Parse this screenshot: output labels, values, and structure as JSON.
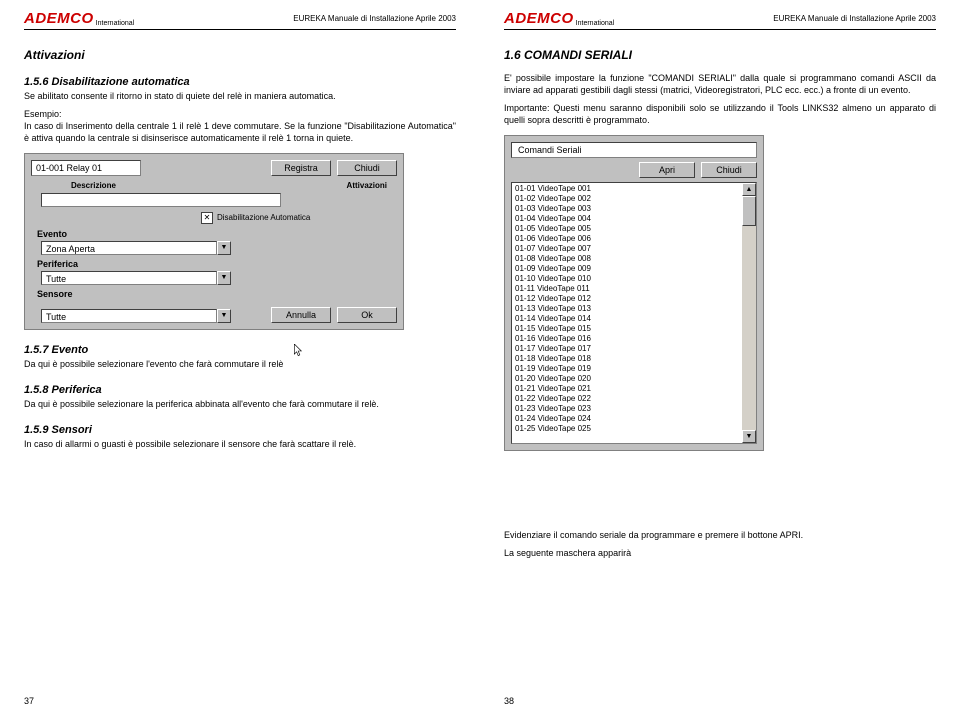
{
  "header": {
    "logo_main": "ADEMCO",
    "logo_sub": "International",
    "doc_title": "EUREKA Manuale di Installazione Aprile 2003"
  },
  "left": {
    "title": "Attivazioni",
    "s156_title": "1.5.6 Disabilitazione automatica",
    "s156_p1": "Se abilitato consente il ritorno in stato di quiete del relè in maniera automatica.",
    "s156_p2": "Esempio:",
    "s156_p3": "In caso di Inserimento della centrale 1 il relè 1 deve commutare. Se la funzione \"Disabilitazione Automatica\" è attiva quando la centrale si disinserisce automaticamente il relè 1 torna in quiete.",
    "shot1": {
      "id_value": "01-001 Relay 01",
      "btn_registra": "Registra",
      "btn_chiudi": "Chiudi",
      "lbl_descrizione": "Descrizione",
      "lbl_attivazioni": "Attivazioni",
      "chk_label": "Disabilitazione Automatica",
      "evento_label": "Evento",
      "evento_value": "Zona Aperta",
      "periferica_label": "Periferica",
      "periferica_value": "Tutte",
      "sensore_label": "Sensore",
      "sensore_value": "Tutte",
      "btn_annulla": "Annulla",
      "btn_ok": "Ok"
    },
    "s157_title": "1.5.7 Evento",
    "s157_p": "Da qui è possibile selezionare l'evento che farà commutare il relè",
    "s158_title": "1.5.8 Periferica",
    "s158_p": "Da qui è possibile selezionare la periferica abbinata all'evento che farà commutare il relè.",
    "s159_title": "1.5.9 Sensori",
    "s159_p": "In caso di allarmi o guasti è possibile selezionare il sensore che farà scattare il relè.",
    "page_num": "37"
  },
  "right": {
    "title": "1.6 COMANDI SERIALI",
    "p1": "E' possibile impostare la funzione \"COMANDI SERIALI\" dalla quale si programmano comandi ASCII da inviare ad apparati gestibili dagli stessi (matrici, Videoregistratori, PLC ecc. ecc.) a fronte di un evento.",
    "p2": "Importante: Questi menu saranno disponibili solo se utilizzando il Tools LINKS32 almeno un apparato di quelli sopra descritti è programmato.",
    "shot2": {
      "title": "Comandi Seriali",
      "btn_apri": "Apri",
      "btn_chiudi": "Chiudi",
      "items": [
        "01-01 VideoTape 001",
        "01-02 VideoTape 002",
        "01-03 VideoTape 003",
        "01-04 VideoTape 004",
        "01-05 VideoTape 005",
        "01-06 VideoTape 006",
        "01-07 VideoTape 007",
        "01-08 VideoTape 008",
        "01-09 VideoTape 009",
        "01-10 VideoTape 010",
        "01-11 VideoTape 011",
        "01-12 VideoTape 012",
        "01-13 VideoTape 013",
        "01-14 VideoTape 014",
        "01-15 VideoTape 015",
        "01-16 VideoTape 016",
        "01-17 VideoTape 017",
        "01-18 VideoTape 018",
        "01-19 VideoTape 019",
        "01-20 VideoTape 020",
        "01-21 VideoTape 021",
        "01-22 VideoTape 022",
        "01-23 VideoTape 023",
        "01-24 VideoTape 024",
        "01-25 VideoTape 025"
      ]
    },
    "p3": "Evidenziare il comando seriale da programmare e premere il bottone APRI.",
    "p4": "La seguente maschera apparirà",
    "page_num": "38"
  }
}
